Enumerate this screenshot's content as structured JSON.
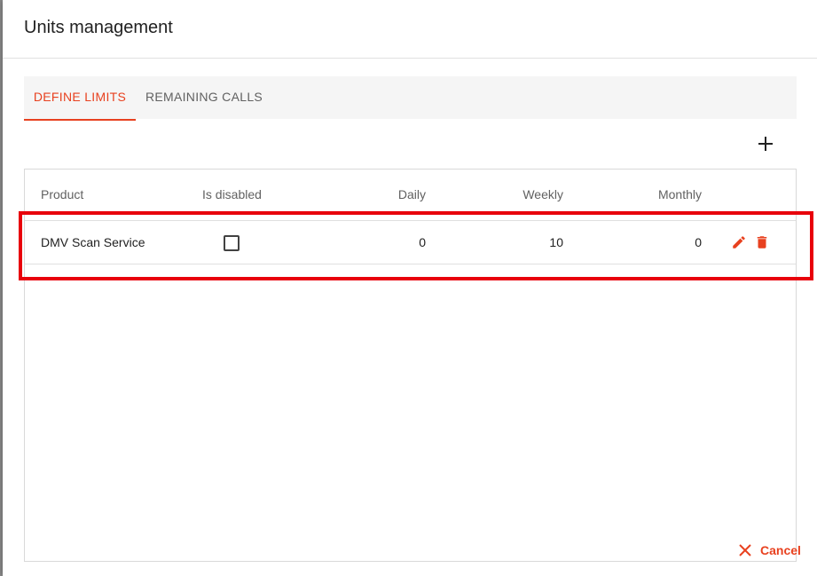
{
  "dialog": {
    "title": "Units management"
  },
  "tabs": [
    {
      "label": "DEFINE LIMITS",
      "active": true
    },
    {
      "label": "REMAINING CALLS",
      "active": false
    }
  ],
  "toolbar": {
    "add_icon": "plus-icon"
  },
  "table": {
    "columns": [
      "Product",
      "Is disabled",
      "Daily",
      "Weekly",
      "Monthly"
    ],
    "rows": [
      {
        "product": "DMV Scan Service",
        "is_disabled": false,
        "daily": "0",
        "weekly": "10",
        "monthly": "0",
        "actions": [
          "edit-icon",
          "delete-icon"
        ]
      }
    ]
  },
  "footer": {
    "cancel_label": "Cancel",
    "cancel_icon": "close-icon"
  },
  "colors": {
    "accent": "#e8411f",
    "highlight": "#e8000b"
  }
}
